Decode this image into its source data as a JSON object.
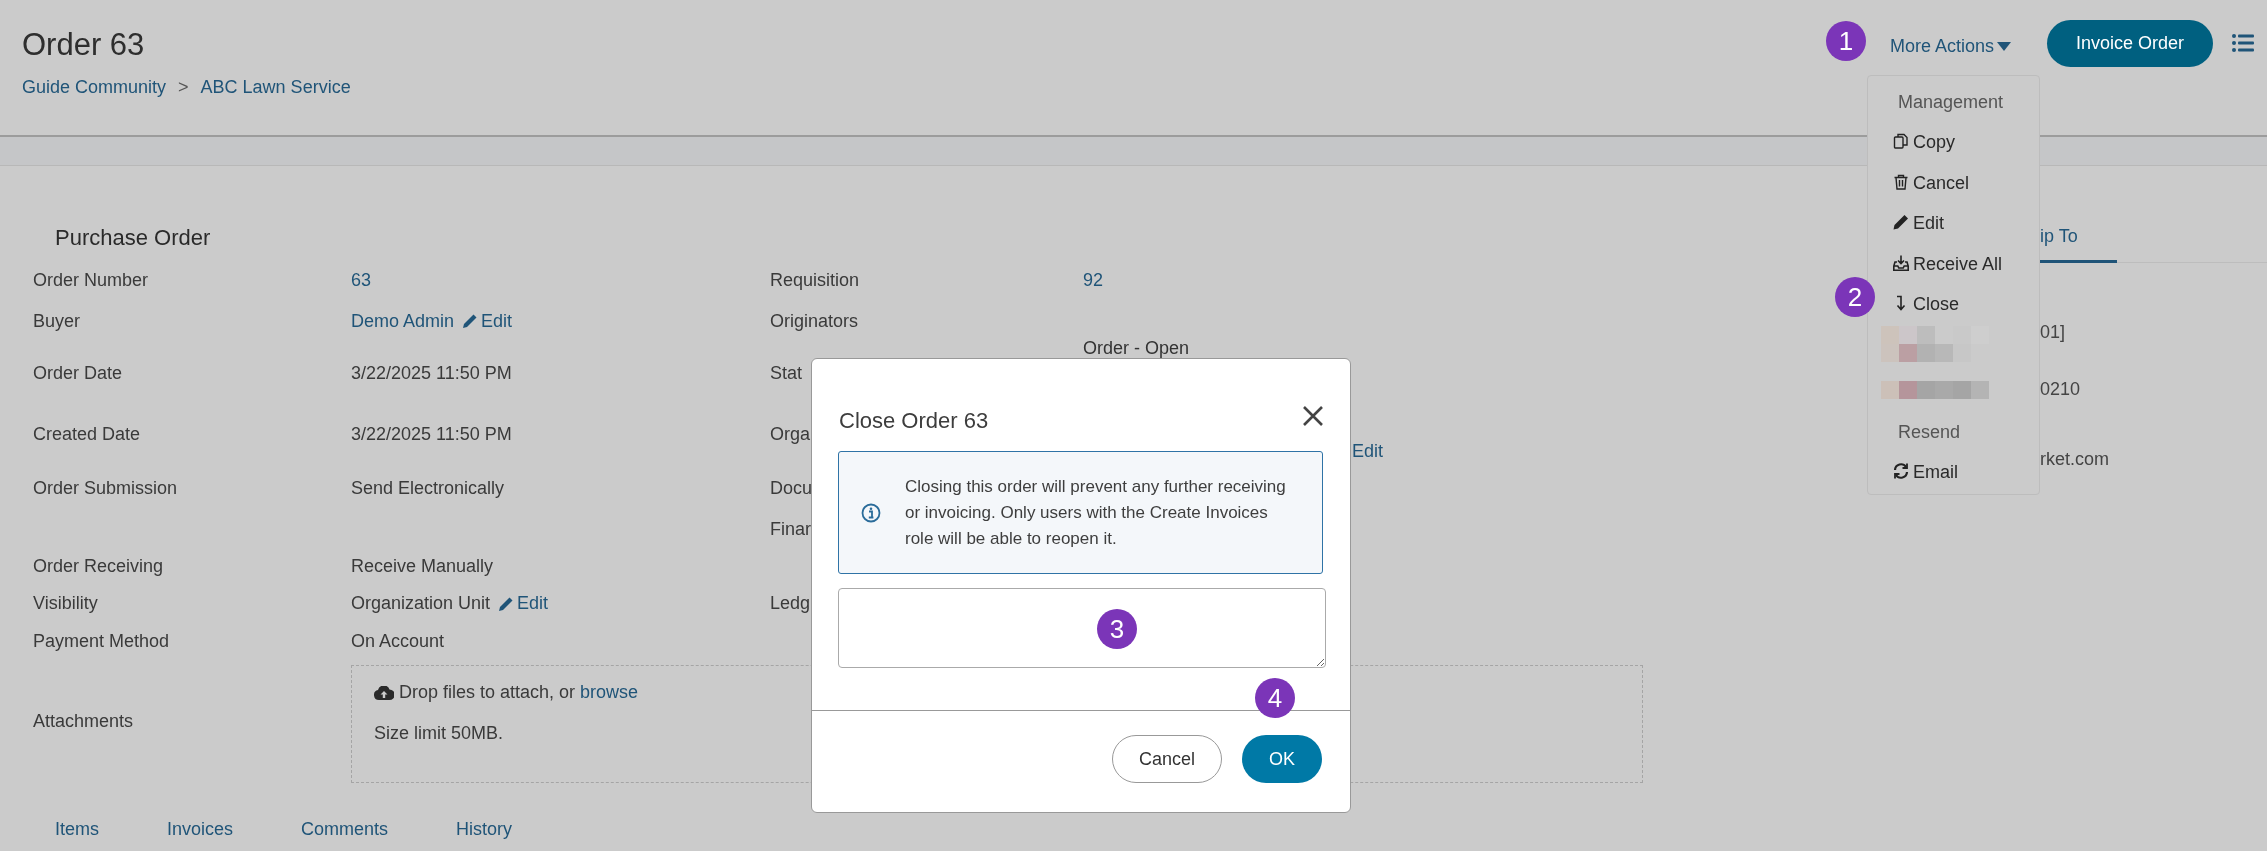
{
  "header": {
    "title": "Order 63",
    "breadcrumb": [
      "Guide Community",
      "ABC Lawn Service"
    ],
    "separator": ">",
    "more_actions": "More Actions",
    "primary_button": "Invoice Order"
  },
  "section_title": "Purchase Order",
  "rows": [
    {
      "label": "Order Number",
      "value": "63",
      "link": true,
      "side_label": "Requisition",
      "side_value": "92"
    },
    {
      "label": "Buyer",
      "value": "Demo Admin",
      "link": true,
      "edit": "Edit",
      "side_label": "Originators"
    },
    {
      "label": "Order Date",
      "value": "3/22/2025 11:50 PM",
      "link": false,
      "side_label": "Stat",
      "side_value": "Order - Open"
    },
    {
      "label": "Created Date",
      "value": "3/22/2025 11:50 PM",
      "link": false,
      "side_label": "Orga",
      "side_value": "Edit"
    },
    {
      "label": "Order Submission",
      "value": "Send Electronically",
      "link": false,
      "side_label": "Docu"
    },
    {
      "side_label": "Finar"
    },
    {
      "label": "Order Receiving",
      "value": "Receive Manually",
      "link": false
    },
    {
      "label": "Visibility",
      "value": "Organization Unit",
      "link": false,
      "edit": "Edit",
      "side_label": "Ledg"
    },
    {
      "label": "Payment Method",
      "value": "On Account",
      "link": false
    }
  ],
  "attachments": {
    "label": "Attachments",
    "drop_text": "Drop files to attach, or ",
    "browse": "browse",
    "limit": "Size limit 50MB."
  },
  "tabs": [
    "Items",
    "Invoices",
    "Comments",
    "History"
  ],
  "side_panel": {
    "tab": "ip To",
    "lines": [
      "01]",
      "0210",
      "rket.com"
    ]
  },
  "menu": [
    {
      "kind": "header",
      "label": "Management"
    },
    {
      "kind": "action",
      "label": "Copy"
    },
    {
      "kind": "action",
      "label": "Cancel"
    },
    {
      "kind": "action",
      "label": "Edit"
    },
    {
      "kind": "action",
      "label": "Receive All"
    },
    {
      "kind": "action",
      "label": "Close"
    },
    {
      "kind": "redacted"
    },
    {
      "kind": "redacted"
    },
    {
      "kind": "header",
      "label": "Resend"
    },
    {
      "kind": "action",
      "label": "Email"
    }
  ],
  "dialog": {
    "title": "Close Order 63",
    "message": "Closing this order will prevent any further receiving or invoicing. Only users with the Create Invoices role will be able to reopen it.",
    "buttons": [
      {
        "label": "Cancel",
        "kind": "secondary"
      },
      {
        "label": "OK",
        "kind": "primary"
      }
    ]
  },
  "annotations": [
    "1",
    "2",
    "3",
    "4"
  ]
}
